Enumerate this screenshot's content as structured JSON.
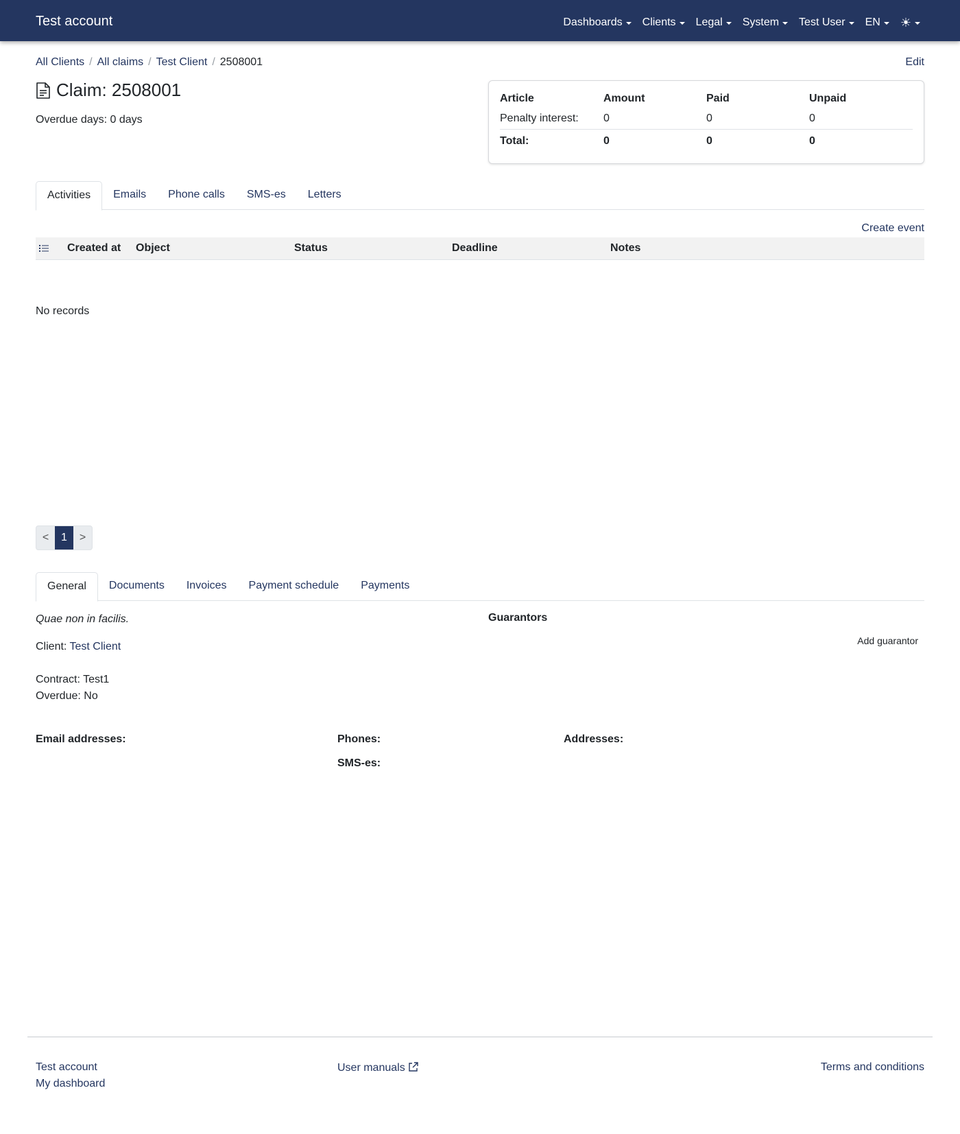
{
  "navbar": {
    "brand": "Test account",
    "items": [
      "Dashboards",
      "Clients",
      "Legal",
      "System",
      "Test User",
      "EN"
    ],
    "theme_icon": "sun-icon"
  },
  "breadcrumb": {
    "items": [
      "All Clients",
      "All claims",
      "Test Client"
    ],
    "current": "2508001",
    "edit": "Edit"
  },
  "claim": {
    "title": "Claim: 2508001",
    "overdue_days": "Overdue days: 0 days"
  },
  "summary": {
    "headers": [
      "Article",
      "Amount",
      "Paid",
      "Unpaid"
    ],
    "rows": [
      [
        "Penalty interest:",
        "0",
        "0",
        "0"
      ]
    ],
    "total": [
      "Total:",
      "0",
      "0",
      "0"
    ]
  },
  "activity_tabs": [
    "Activities",
    "Emails",
    "Phone calls",
    "SMS-es",
    "Letters"
  ],
  "create_event": "Create event",
  "activity_columns": [
    "Created at",
    "Object",
    "Status",
    "Deadline",
    "Notes"
  ],
  "no_records": "No records",
  "pagination": {
    "prev": "<",
    "current": "1",
    "next": ">"
  },
  "detail_tabs": [
    "General",
    "Documents",
    "Invoices",
    "Payment schedule",
    "Payments"
  ],
  "general": {
    "description": "Quae non in facilis.",
    "client_label": "Client:",
    "client_value": "Test Client",
    "contract": "Contract: Test1",
    "overdue": "Overdue: No",
    "guarantors": "Guarantors",
    "add_guarantor": "Add guarantor",
    "email_label": "Email addresses:",
    "phones_label": "Phones:",
    "sms_label": "SMS-es:",
    "addresses_label": "Addresses:"
  },
  "footer": {
    "account": "Test account",
    "dashboard": "My dashboard",
    "manuals": "User manuals",
    "terms": "Terms and conditions"
  },
  "colors": {
    "primary": "#243660"
  }
}
